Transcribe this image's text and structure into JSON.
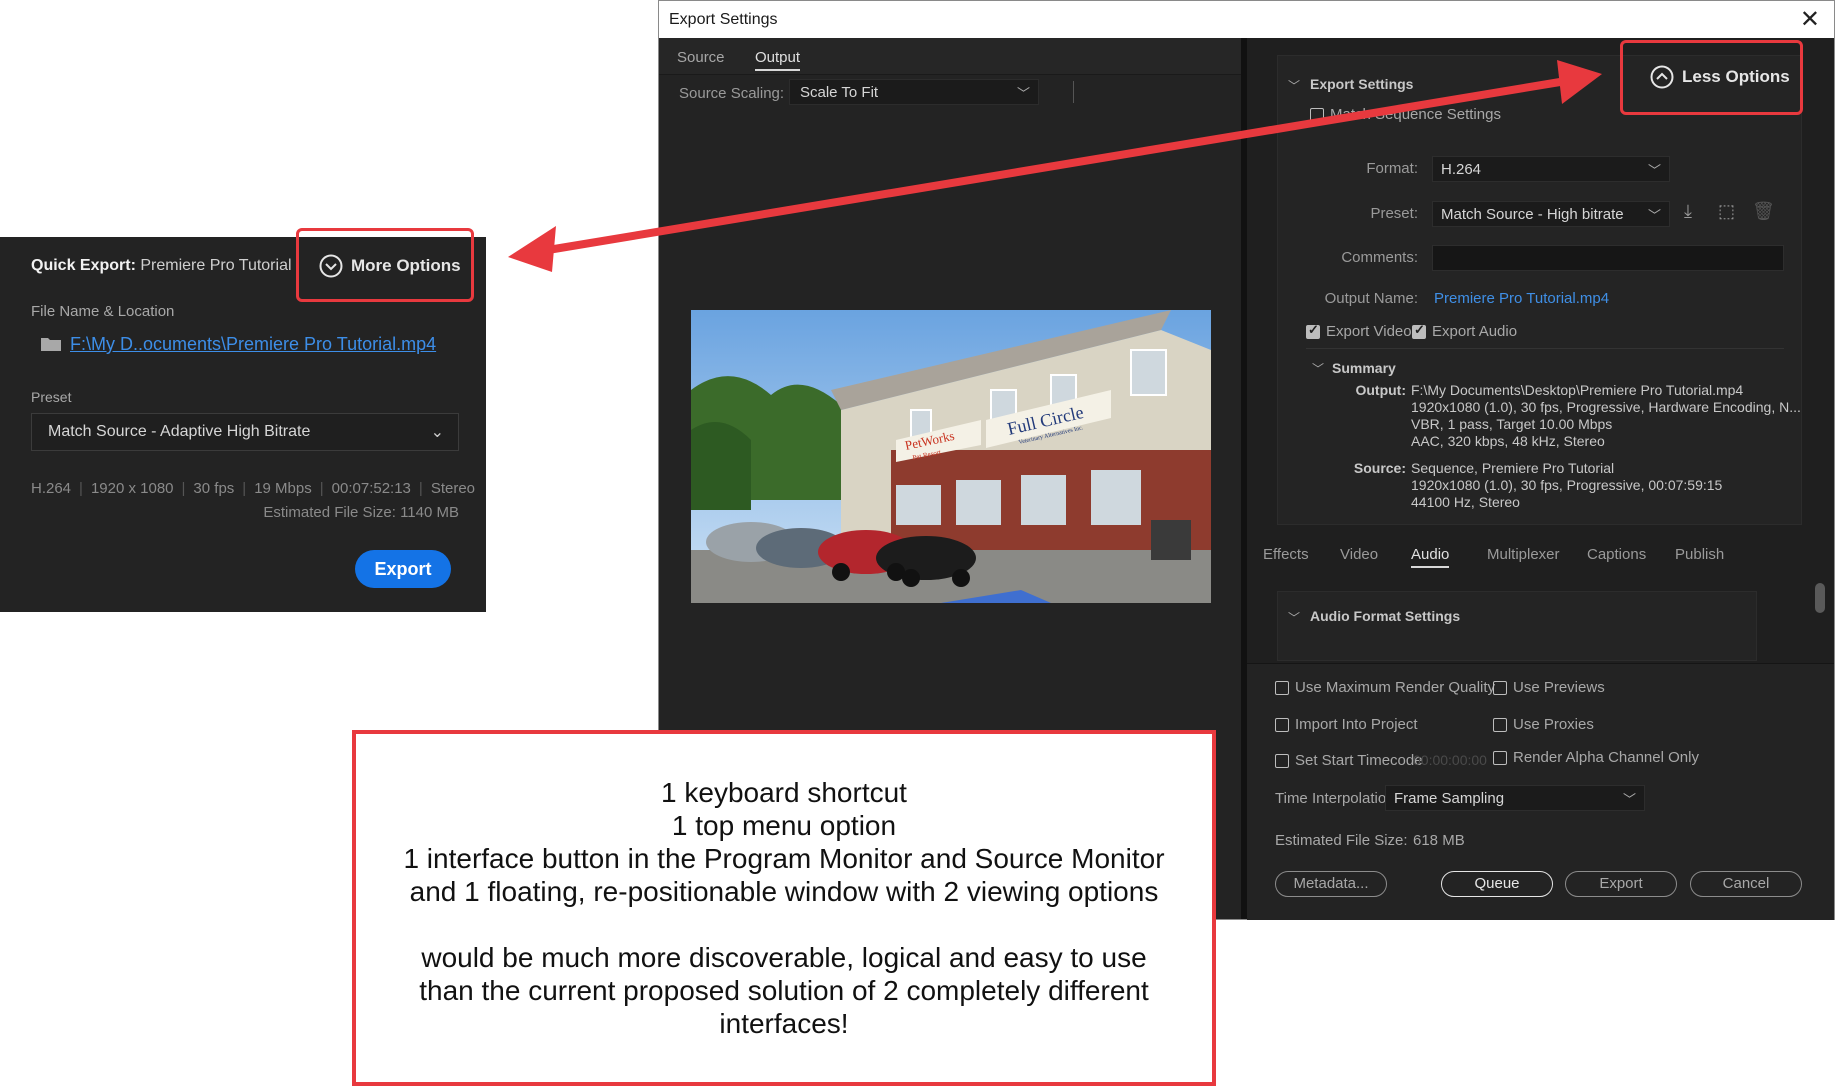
{
  "export_settings": {
    "window_title": "Export Settings",
    "close_glyph": "✕",
    "tabs": [
      "Source",
      "Output"
    ],
    "source_scaling_label": "Source Scaling:",
    "source_scaling_value": "Scale To Fit",
    "section_title": "Export Settings",
    "less_options_label": "Less Options",
    "match_sequence_label": "Match Sequence Settings",
    "format_label": "Format:",
    "format_value": "H.264",
    "preset_label": "Preset:",
    "preset_value": "Match Source - High bitrate",
    "comments_label": "Comments:",
    "comments_value": "",
    "output_name_label": "Output Name:",
    "output_name_value": "Premiere Pro Tutorial.mp4",
    "export_video_label": "Export Video",
    "export_audio_label": "Export Audio",
    "summary_title": "Summary",
    "summary_output_label": "Output:",
    "summary_output_lines": [
      "F:\\My Documents\\Desktop\\Premiere Pro Tutorial.mp4",
      "1920x1080 (1.0), 30 fps, Progressive, Hardware Encoding, N...",
      "VBR, 1 pass, Target 10.00 Mbps",
      "AAC, 320 kbps, 48 kHz, Stereo"
    ],
    "summary_source_label": "Source:",
    "summary_source_lines": [
      "Sequence, Premiere Pro Tutorial",
      "1920x1080 (1.0), 30 fps, Progressive, 00:07:59:15",
      "44100 Hz, Stereo"
    ],
    "bottom_tabs": [
      "Effects",
      "Video",
      "Audio",
      "Multiplexer",
      "Captions",
      "Publish"
    ],
    "audio_format_title": "Audio Format Settings",
    "use_max_render_label": "Use Maximum Render Quality",
    "use_previews_label": "Use Previews",
    "import_into_project_label": "Import Into Project",
    "use_proxies_label": "Use Proxies",
    "set_start_timecode_label": "Set Start Timecode",
    "start_timecode_value": "00:00:00:00",
    "render_alpha_label": "Render Alpha Channel Only",
    "time_interp_label": "Time Interpolation:",
    "time_interp_value": "Frame Sampling",
    "est_file_size_label": "Estimated File Size:",
    "est_file_size_value": "618 MB",
    "buttons": {
      "metadata": "Metadata...",
      "queue": "Queue",
      "export": "Export",
      "cancel": "Cancel"
    },
    "preview_sign_text": "PetWorks",
    "preview_sign_sub": "Pet Resort",
    "preview_sign_text2": "Full Circle",
    "preview_sign_sub2": "Veterinary Alternatives Inc."
  },
  "quick_export": {
    "title_bold": "Quick Export:",
    "title_rest": " Premiere Pro Tutorial",
    "more_options_label": "More Options",
    "file_name_label": "File Name & Location",
    "file_path": "F:\\My D..ocuments\\Premiere Pro Tutorial.mp4",
    "preset_label": "Preset",
    "preset_value": "Match Source - Adaptive High Bitrate",
    "specs": [
      "H.264",
      "1920 x 1080",
      "30 fps",
      "19 Mbps",
      "00:07:52:13",
      "Stereo"
    ],
    "estimated_size": "Estimated File Size: 1140 MB",
    "export_label": "Export"
  },
  "annotation": {
    "lines_top": [
      "1 keyboard shortcut",
      "1 top menu option",
      "1 interface button in the Program Monitor and Source Monitor",
      "and 1 floating, re-positionable window with 2 viewing options"
    ],
    "lines_bottom": [
      "would be much more discoverable, logical and easy to use",
      "than the current proposed solution of 2 completely different",
      "interfaces!"
    ]
  },
  "colors": {
    "accent_blue": "#1473e6",
    "annotation_red": "#e8393e",
    "panel_dark": "#232323"
  }
}
